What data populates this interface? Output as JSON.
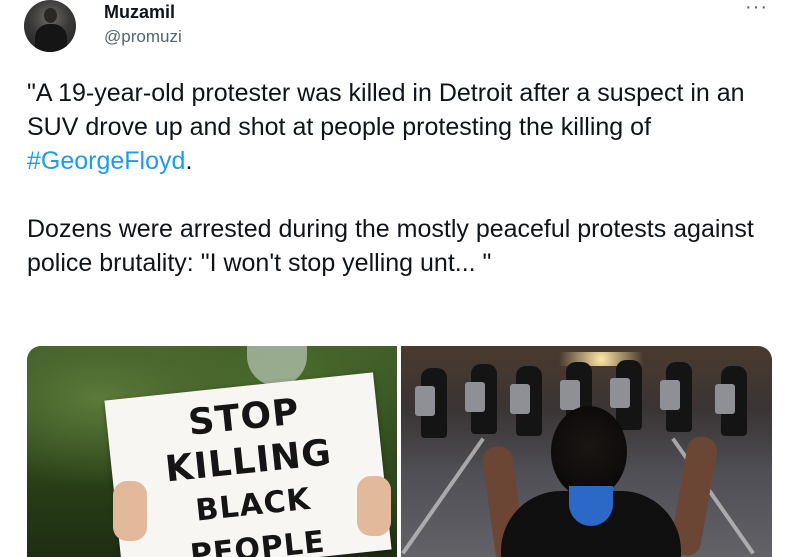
{
  "author": {
    "name": "Muzamil",
    "handle": "@promuzi",
    "avatar_icon": "user-avatar"
  },
  "more_label": "···",
  "tweet": {
    "para1_prefix": "\"A 19-year-old protester was killed in Detroit after a suspect in an SUV drove up and shot at people protesting the killing of ",
    "hashtag": "#GeorgeFloyd",
    "para1_suffix": ".",
    "para2": "Dozens were arrested during the mostly peaceful protests against police brutality: \"I won't stop yelling unt... \""
  },
  "media": {
    "left_sign_lines": [
      "STOP",
      "KILLING",
      "BLACK PEOPLE"
    ]
  },
  "colors": {
    "hashtag": "#1d9bf0",
    "handle": "#536471",
    "text": "#0f1419"
  }
}
